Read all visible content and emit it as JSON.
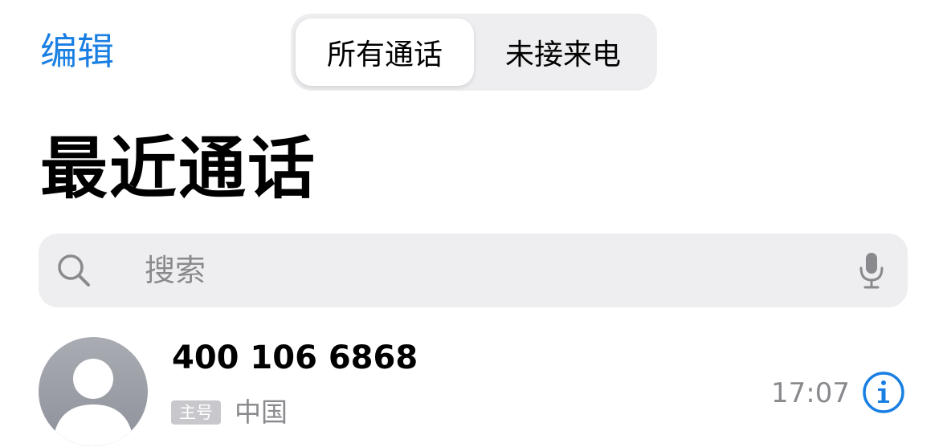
{
  "header": {
    "edit_label": "编辑",
    "segments": [
      {
        "label": "所有通话",
        "selected": true
      },
      {
        "label": "未接来电",
        "selected": false
      }
    ]
  },
  "page_title": "最近通话",
  "search": {
    "placeholder": "搜索",
    "search_icon": "magnifier-icon",
    "mic_icon": "microphone-icon"
  },
  "calls": [
    {
      "number": "400 106 6868",
      "badge": "主号",
      "location": "中国",
      "time": "17:07",
      "info_icon": "info-icon",
      "avatar_icon": "person-silhouette-icon"
    }
  ],
  "colors": {
    "accent": "#1a7fe3",
    "secondary_text": "#8a8a8e",
    "search_background": "#eeeef0",
    "avatar": "#9b9ea5"
  }
}
